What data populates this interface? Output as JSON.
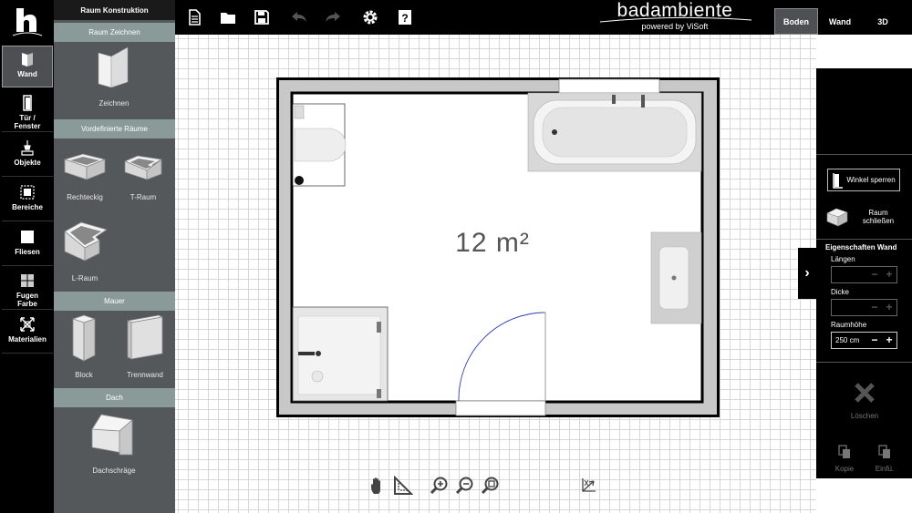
{
  "app": {
    "brand_name": "badambiente",
    "brand_tagline": "powered by ViSoft"
  },
  "view_tabs": [
    {
      "label": "Boden",
      "active": true
    },
    {
      "label": "Wand",
      "active": false
    },
    {
      "label": "3D",
      "active": false
    }
  ],
  "toolbar_icons": [
    "new-file-icon",
    "open-folder-icon",
    "save-icon",
    "undo-icon",
    "redo-icon",
    "settings-icon",
    "help-icon"
  ],
  "rail": {
    "items": [
      {
        "label": "Wand",
        "icon": "wall-icon",
        "active": true
      },
      {
        "label": "Tür / Fenster",
        "icon": "door-icon",
        "active": false
      },
      {
        "label": "Objekte",
        "icon": "objects-icon",
        "active": false
      },
      {
        "label": "Bereiche",
        "icon": "areas-icon",
        "active": false
      },
      {
        "label": "Fliesen",
        "icon": "tiles-icon",
        "active": false
      },
      {
        "label": "Fugen Farbe",
        "icon": "grout-color-icon",
        "active": false
      },
      {
        "label": "Materialien",
        "icon": "materials-icon",
        "active": false
      }
    ]
  },
  "panel": {
    "title": "Raum Konstruktion",
    "sections": {
      "draw": "Raum Zeichnen",
      "predefined": "Vordefinierte Räume",
      "wall": "Mauer",
      "roof": "Dach"
    },
    "tools": {
      "draw": "Zeichnen",
      "rect": "Rechteckig",
      "troom": "T-Raum",
      "lroom": "L-Raum",
      "block": "Block",
      "partition": "Trennwand",
      "slope": "Dachschräge"
    }
  },
  "canvas": {
    "area_label": "12 m²"
  },
  "bottom_tools": [
    "pan-hand-icon",
    "measure-icon",
    "zoom-in-icon",
    "zoom-out-icon",
    "zoom-fit-icon",
    "north-arrow-icon"
  ],
  "right_panel": {
    "angle_lock": "Winkel sperren",
    "close_room": "Raum schließen",
    "properties_title": "Eigenschaften Wand",
    "length_label": "Längen",
    "length_value": "",
    "thickness_label": "Dicke",
    "thickness_value": "",
    "height_label": "Raumhöhe",
    "height_value": "250 cm",
    "delete_label": "Löschen",
    "copy_label": "Kopie",
    "paste_label": "Einfü."
  },
  "colors": {
    "rail_bg": "#000000",
    "panel_bg": "#55585b",
    "section_head": "#8a9a98",
    "wall_fill": "#c8c8c8"
  }
}
